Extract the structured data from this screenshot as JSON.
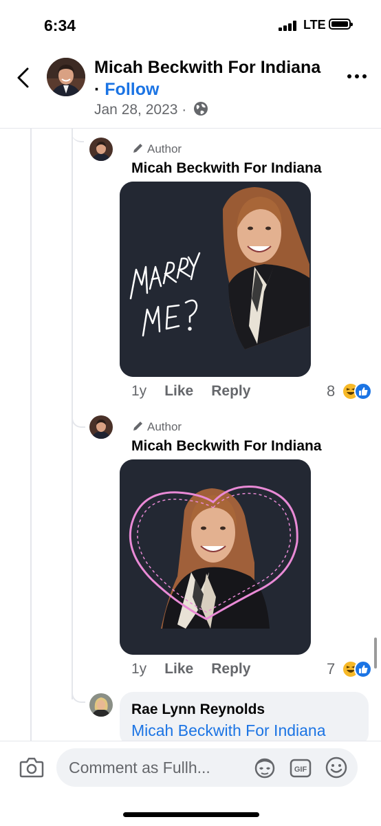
{
  "status_bar": {
    "time": "6:34",
    "network": "LTE"
  },
  "header": {
    "name": "Micah Beckwith For Indiana",
    "separator": "·",
    "follow_label": "Follow",
    "date": "Jan 28, 2023",
    "date_separator": "·",
    "back_icon": "chevron-left-icon",
    "more_icon": "more-horizontal-icon"
  },
  "comments": [
    {
      "badge": "Author",
      "author": "Micah Beckwith For Indiana",
      "image_text": "MARRY ME?",
      "age": "1y",
      "like_label": "Like",
      "reply_label": "Reply",
      "reaction_count": "8",
      "reactions": [
        "haha",
        "like"
      ]
    },
    {
      "badge": "Author",
      "author": "Micah Beckwith For Indiana",
      "age": "1y",
      "like_label": "Like",
      "reply_label": "Reply",
      "reaction_count": "7",
      "reactions": [
        "haha",
        "like"
      ]
    },
    {
      "author": "Rae Lynn Reynolds",
      "mention": "Micah Beckwith For Indiana"
    }
  ],
  "composer": {
    "placeholder": "Comment as Fullh..."
  },
  "colors": {
    "accent": "#1b74e4",
    "secondary_text": "#65676b",
    "image_bg": "#232833",
    "heart": "#e98ad6"
  }
}
